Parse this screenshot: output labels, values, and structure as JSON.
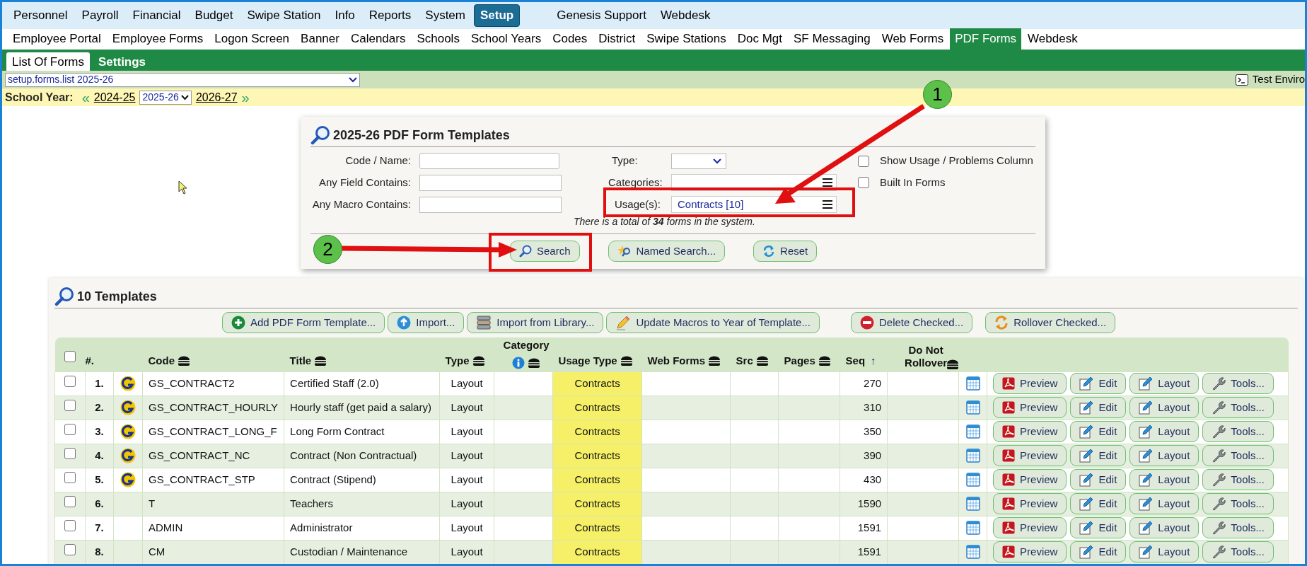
{
  "main_menu": [
    {
      "label": "Personnel",
      "selected": false
    },
    {
      "label": "Payroll",
      "selected": false
    },
    {
      "label": "Financial",
      "selected": false
    },
    {
      "label": "Budget",
      "selected": false
    },
    {
      "label": "Swipe Station",
      "selected": false
    },
    {
      "label": "Info",
      "selected": false
    },
    {
      "label": "Reports",
      "selected": false
    },
    {
      "label": "System",
      "selected": false
    },
    {
      "label": "Setup",
      "selected": true
    }
  ],
  "extra_menu": [
    "Genesis Support",
    "Webdesk"
  ],
  "sub_menu": [
    {
      "label": "Employee Portal",
      "selected": false
    },
    {
      "label": "Employee Forms",
      "selected": false
    },
    {
      "label": "Logon Screen",
      "selected": false
    },
    {
      "label": "Banner",
      "selected": false
    },
    {
      "label": "Calendars",
      "selected": false
    },
    {
      "label": "Schools",
      "selected": false
    },
    {
      "label": "School Years",
      "selected": false
    },
    {
      "label": "Codes",
      "selected": false
    },
    {
      "label": "District",
      "selected": false
    },
    {
      "label": "Swipe Stations",
      "selected": false
    },
    {
      "label": "Doc Mgt",
      "selected": false
    },
    {
      "label": "SF Messaging",
      "selected": false
    },
    {
      "label": "Web Forms",
      "selected": false
    },
    {
      "label": "PDF Forms",
      "selected": true
    },
    {
      "label": "Webdesk",
      "selected": false
    }
  ],
  "page_tabs": [
    {
      "label": "List Of Forms",
      "selected": true
    },
    {
      "label": "Settings",
      "selected": false
    }
  ],
  "screen_select": "setup.forms.list 2025-26",
  "environment": "Test Enviro",
  "school_year": {
    "label": "School Year:",
    "prev_mark": "«",
    "prev": "2024-25",
    "current": "2025-26",
    "next": "2026-27",
    "next_mark": "»"
  },
  "search_panel": {
    "title": "2025-26 PDF Form Templates",
    "code_label": "Code / Name:",
    "field_label": "Any Field Contains:",
    "macro_label": "Any Macro Contains:",
    "type_label": "Type:",
    "categories_label": "Categories:",
    "usage_label": "Usage(s):",
    "usage_value": "Contracts [10]",
    "options": [
      {
        "label": "Show Usage / Problems Column",
        "checked": false
      },
      {
        "label": "Built In Forms",
        "checked": false
      }
    ],
    "total": "There is a total of **34** forms in the system.",
    "buttons": [
      {
        "kind": "search",
        "label": "Search"
      },
      {
        "kind": "named",
        "label": "Named Search..."
      },
      {
        "kind": "reset",
        "label": "Reset"
      }
    ]
  },
  "annotations": [
    "1",
    "2"
  ],
  "templates": {
    "title": "10 Templates",
    "toolbar": [
      {
        "kind": "add",
        "label": "Add PDF Form Template..."
      },
      {
        "kind": "import",
        "label": "Import..."
      },
      {
        "kind": "library",
        "label": "Import from Library..."
      },
      {
        "kind": "update",
        "label": "Update Macros to Year of Template..."
      },
      {
        "kind": "delete",
        "label": "Delete Checked..."
      },
      {
        "kind": "rollover",
        "label": "Rollover Checked..."
      }
    ],
    "header_checked": false,
    "columns": [
      {
        "label": "#.",
        "sort_menu": false,
        "info": false
      },
      {
        "label": "Code",
        "sort_menu": true,
        "info": false
      },
      {
        "label": "Title",
        "sort_menu": true,
        "info": false
      },
      {
        "label": "Type",
        "sort_menu": true,
        "info": false
      },
      {
        "label": "Category",
        "sort_menu": true,
        "info": true
      },
      {
        "label": "Usage Type",
        "sort_menu": true,
        "info": false
      },
      {
        "label": "Web Forms",
        "sort_menu": true,
        "info": false
      },
      {
        "label": "Src",
        "sort_menu": true,
        "info": false
      },
      {
        "label": "Pages",
        "sort_menu": true,
        "info": false
      },
      {
        "label": "Seq",
        "sort_menu": false,
        "sort_arrow": "↑",
        "info": false
      },
      {
        "label": "Do Not Rollover",
        "sort_menu": true,
        "info": false
      }
    ],
    "rows": [
      {
        "checked": false,
        "num": "1.",
        "logo": true,
        "code": "GS_CONTRACT2",
        "title": "Certified Staff (2.0)",
        "type": "Layout",
        "usage": "Contracts",
        "seq": "270",
        "actions": [
          {
            "kind": "pdf",
            "label": "Preview"
          },
          {
            "kind": "edit",
            "label": "Edit"
          },
          {
            "kind": "edit",
            "label": "Layout"
          },
          {
            "kind": "tools",
            "label": "Tools..."
          }
        ]
      },
      {
        "checked": false,
        "num": "2.",
        "logo": true,
        "code": "GS_CONTRACT_HOURLY",
        "title": "Hourly staff (get paid a salary)",
        "type": "Layout",
        "usage": "Contracts",
        "seq": "310",
        "actions": [
          {
            "kind": "pdf",
            "label": "Preview"
          },
          {
            "kind": "edit",
            "label": "Edit"
          },
          {
            "kind": "edit",
            "label": "Layout"
          },
          {
            "kind": "tools",
            "label": "Tools..."
          }
        ]
      },
      {
        "checked": false,
        "num": "3.",
        "logo": true,
        "code": "GS_CONTRACT_LONG_F",
        "title": "Long Form Contract",
        "type": "Layout",
        "usage": "Contracts",
        "seq": "350",
        "actions": [
          {
            "kind": "pdf",
            "label": "Preview"
          },
          {
            "kind": "edit",
            "label": "Edit"
          },
          {
            "kind": "edit",
            "label": "Layout"
          },
          {
            "kind": "tools",
            "label": "Tools..."
          }
        ]
      },
      {
        "checked": false,
        "num": "4.",
        "logo": true,
        "code": "GS_CONTRACT_NC",
        "title": "Contract (Non Contractual)",
        "type": "Layout",
        "usage": "Contracts",
        "seq": "390",
        "actions": [
          {
            "kind": "pdf",
            "label": "Preview"
          },
          {
            "kind": "edit",
            "label": "Edit"
          },
          {
            "kind": "edit",
            "label": "Layout"
          },
          {
            "kind": "tools",
            "label": "Tools..."
          }
        ]
      },
      {
        "checked": false,
        "num": "5.",
        "logo": true,
        "code": "GS_CONTRACT_STP",
        "title": "Contract (Stipend)",
        "type": "Layout",
        "usage": "Contracts",
        "seq": "430",
        "actions": [
          {
            "kind": "pdf",
            "label": "Preview"
          },
          {
            "kind": "edit",
            "label": "Edit"
          },
          {
            "kind": "edit",
            "label": "Layout"
          },
          {
            "kind": "tools",
            "label": "Tools..."
          }
        ]
      },
      {
        "checked": false,
        "num": "6.",
        "logo": false,
        "code": "T",
        "title": "Teachers",
        "type": "Layout",
        "usage": "Contracts",
        "seq": "1590",
        "actions": [
          {
            "kind": "pdf",
            "label": "Preview"
          },
          {
            "kind": "edit",
            "label": "Edit"
          },
          {
            "kind": "edit",
            "label": "Layout"
          },
          {
            "kind": "tools",
            "label": "Tools..."
          }
        ]
      },
      {
        "checked": false,
        "num": "7.",
        "logo": false,
        "code": "ADMIN",
        "title": "Administrator",
        "type": "Layout",
        "usage": "Contracts",
        "seq": "1591",
        "actions": [
          {
            "kind": "pdf",
            "label": "Preview"
          },
          {
            "kind": "edit",
            "label": "Edit"
          },
          {
            "kind": "edit",
            "label": "Layout"
          },
          {
            "kind": "tools",
            "label": "Tools..."
          }
        ]
      },
      {
        "checked": false,
        "num": "8.",
        "logo": false,
        "code": "CM",
        "title": "Custodian / Maintenance",
        "type": "Layout",
        "usage": "Contracts",
        "seq": "1591",
        "actions": [
          {
            "kind": "pdf",
            "label": "Preview"
          },
          {
            "kind": "edit",
            "label": "Edit"
          },
          {
            "kind": "edit",
            "label": "Layout"
          },
          {
            "kind": "tools",
            "label": "Tools..."
          }
        ]
      }
    ]
  }
}
